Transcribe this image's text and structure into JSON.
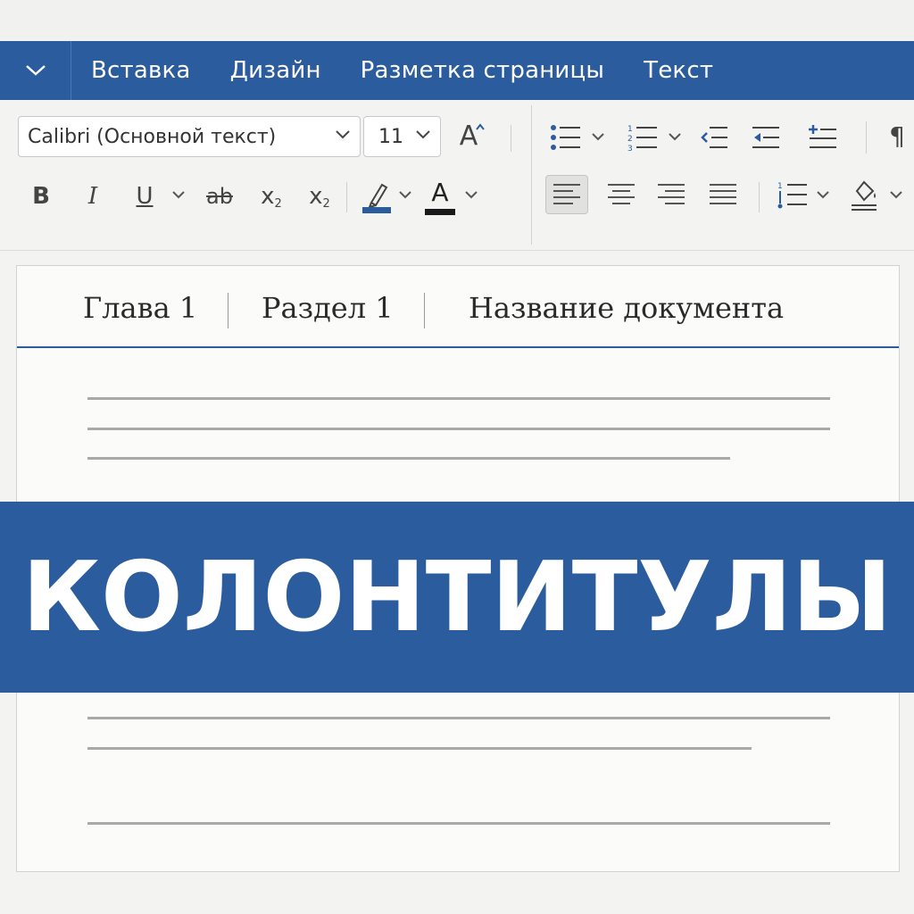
{
  "menu": {
    "tabs": [
      "Вставка",
      "Дизайн",
      "Разметка страницы",
      "Текст"
    ]
  },
  "ribbon": {
    "font_name": "Calibri (Основной текст)",
    "font_size": "11",
    "bold_label": "B",
    "italic_label": "I",
    "underline_label": "U",
    "strike_label": "ab",
    "subscript_label": "x",
    "superscript_label": "x",
    "sub_mark": "2",
    "highlight_color": "#2b5c9e",
    "font_color": "#1a1a1a",
    "font_color_label": "A",
    "grow_font_label": "A",
    "pilcrow": "¶"
  },
  "document": {
    "header": {
      "chapter": "Глава 1",
      "section": "Раздел 1",
      "doc_title": "Название документа"
    }
  },
  "banner": {
    "title": "КОЛОНТИТУЛЫ"
  },
  "colors": {
    "accent": "#2b5c9e",
    "ribbon_bg": "#f3f3f1",
    "page_bg": "#fbfbfa"
  }
}
